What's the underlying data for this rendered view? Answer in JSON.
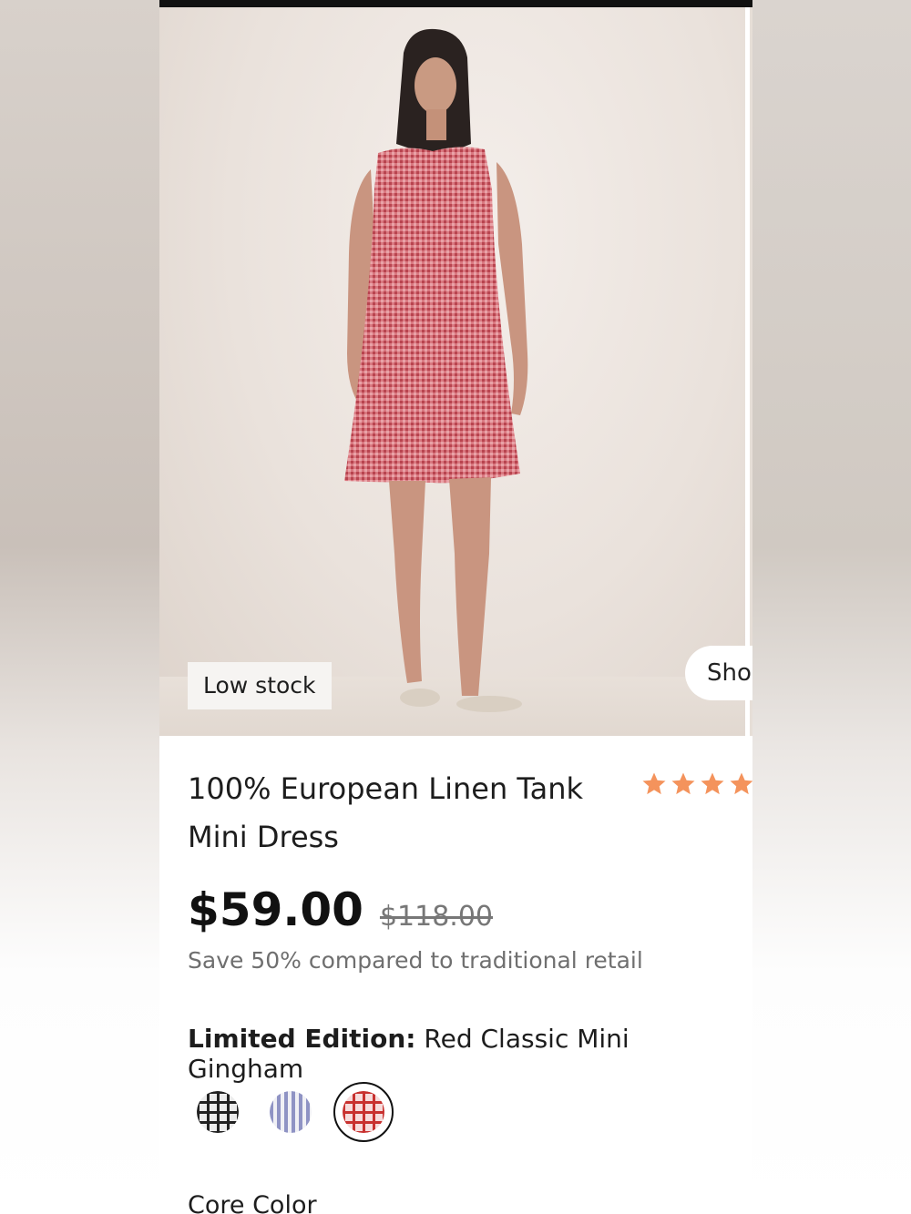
{
  "product": {
    "badge": "Low stock",
    "next_card_label": "Sho",
    "title_line1": "100% European Linen Tank",
    "title_line2": "Mini Dress",
    "rating_stars": 4,
    "price": "$59.00",
    "original_price": "$118.00",
    "savings": "Save 50% compared to traditional retail",
    "edition_label": "Limited Edition:",
    "edition_value": "Red Classic Mini Gingham",
    "core_color_label": "Core Color"
  },
  "swatches": [
    {
      "name": "black-gingham",
      "color": "#222222",
      "selected": false
    },
    {
      "name": "blue-stripe",
      "color": "#8f93c4",
      "selected": false
    },
    {
      "name": "red-gingham",
      "color": "#c8312f",
      "selected": true
    }
  ],
  "colors": {
    "star": "#f4935c",
    "dress": "#d46d76"
  }
}
